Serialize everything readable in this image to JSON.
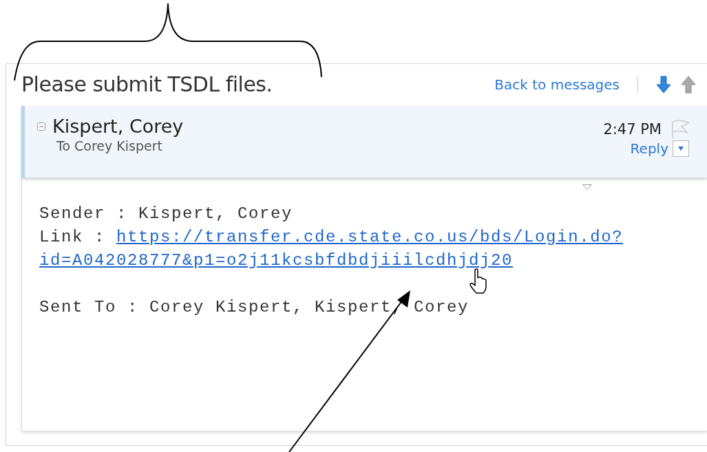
{
  "subject": "Please submit TSDL files.",
  "nav": {
    "back_link": "Back to messages"
  },
  "message": {
    "sender": "Kispert, Corey",
    "recipients": "To Corey Kispert",
    "time": "2:47 PM",
    "reply": "Reply"
  },
  "body": [
    {
      "kind": "field",
      "text": "Sender : Kispert, Corey"
    },
    {
      "kind": "link",
      "label": "Link :",
      "url_lines": [
        "https://transfer.cde.state.co.us/bds/Login.do?",
        "id=A042028777&p1=o2j11kcsbfdbdjiiilcdhjdj20"
      ]
    },
    {
      "kind": "field",
      "text": "Sent To : Corey Kispert, Kispert, Corey"
    }
  ]
}
